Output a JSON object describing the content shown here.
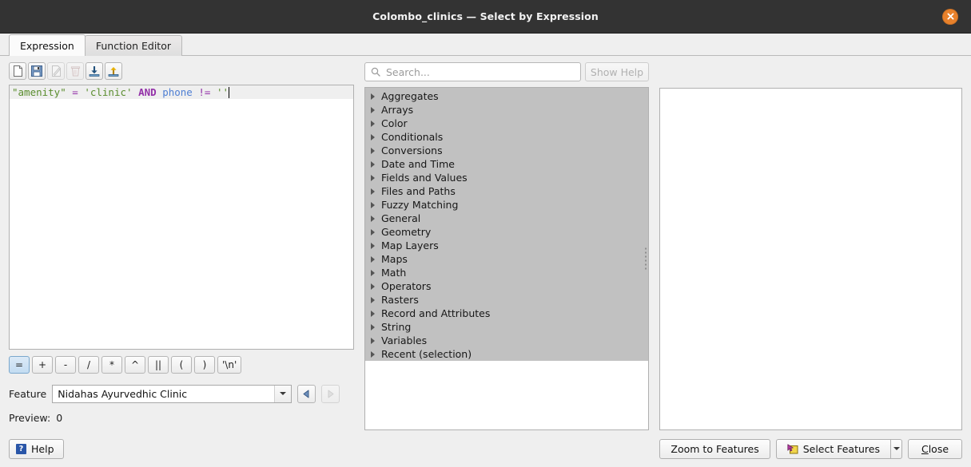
{
  "window": {
    "title": "Colombo_clinics — Select by Expression",
    "close_icon": "close-icon"
  },
  "tabs": [
    {
      "label": "Expression",
      "active": true
    },
    {
      "label": "Function Editor",
      "active": false
    }
  ],
  "expression_toolbar": [
    {
      "name": "new-file-icon",
      "tooltip": "New",
      "enabled": true
    },
    {
      "name": "save-icon",
      "tooltip": "Save",
      "enabled": true
    },
    {
      "name": "edit-icon",
      "tooltip": "Edit",
      "enabled": false
    },
    {
      "name": "delete-icon",
      "tooltip": "Delete",
      "enabled": false
    },
    {
      "name": "import-icon",
      "tooltip": "Import",
      "enabled": true
    },
    {
      "name": "export-icon",
      "tooltip": "Export",
      "enabled": true
    }
  ],
  "expression": {
    "full_text": "\"amenity\" = 'clinic' AND phone != ''",
    "tokens": [
      {
        "text": "\"amenity\"",
        "type": "field"
      },
      {
        "text": " ",
        "type": "plain"
      },
      {
        "text": "=",
        "type": "operator"
      },
      {
        "text": " ",
        "type": "plain"
      },
      {
        "text": "'clinic'",
        "type": "string"
      },
      {
        "text": " ",
        "type": "plain"
      },
      {
        "text": "AND",
        "type": "keyword"
      },
      {
        "text": " ",
        "type": "plain"
      },
      {
        "text": "phone",
        "type": "identifier"
      },
      {
        "text": " ",
        "type": "plain"
      },
      {
        "text": "!=",
        "type": "operator"
      },
      {
        "text": " ",
        "type": "plain"
      },
      {
        "text": "''",
        "type": "string"
      }
    ],
    "colors": {
      "field": "#5a8d2e",
      "operator": "#9330a8",
      "string": "#5a8d2e",
      "keyword": "#9330a8",
      "identifier": "#4f7fd4"
    }
  },
  "operator_buttons": [
    {
      "label": "=",
      "focused": true
    },
    {
      "label": "+",
      "focused": false
    },
    {
      "label": "-",
      "focused": false
    },
    {
      "label": "/",
      "focused": false
    },
    {
      "label": "*",
      "focused": false
    },
    {
      "label": "^",
      "focused": false
    },
    {
      "label": "||",
      "focused": false
    },
    {
      "label": "(",
      "focused": false
    },
    {
      "label": ")",
      "focused": false
    },
    {
      "label": "'\\n'",
      "focused": false
    }
  ],
  "feature": {
    "label": "Feature",
    "value": "Nidahas Ayurvedhic Clinic",
    "prev_enabled": true,
    "next_enabled": false
  },
  "preview": {
    "label": "Preview:",
    "value": "0"
  },
  "search": {
    "placeholder": "Search...",
    "value": "",
    "icon": "search-icon"
  },
  "show_help_button": {
    "label": "Show Help",
    "enabled": false
  },
  "function_groups": [
    "Aggregates",
    "Arrays",
    "Color",
    "Conditionals",
    "Conversions",
    "Date and Time",
    "Fields and Values",
    "Files and Paths",
    "Fuzzy Matching",
    "General",
    "Geometry",
    "Map Layers",
    "Maps",
    "Math",
    "Operators",
    "Rasters",
    "Record and Attributes",
    "String",
    "Variables",
    "Recent (selection)"
  ],
  "bottom_bar": {
    "help_label": "Help",
    "zoom_to_features_label": "Zoom to Features",
    "select_features_label": "Select Features",
    "close_label": "Close",
    "close_accel": "C"
  },
  "theme": {
    "titlebar_bg": "#333333",
    "close_button_bg": "#e8812b",
    "dialog_bg": "#efefef",
    "list_selection_bg": "#c1c1c1",
    "accent_blue": "#2a56a8"
  }
}
